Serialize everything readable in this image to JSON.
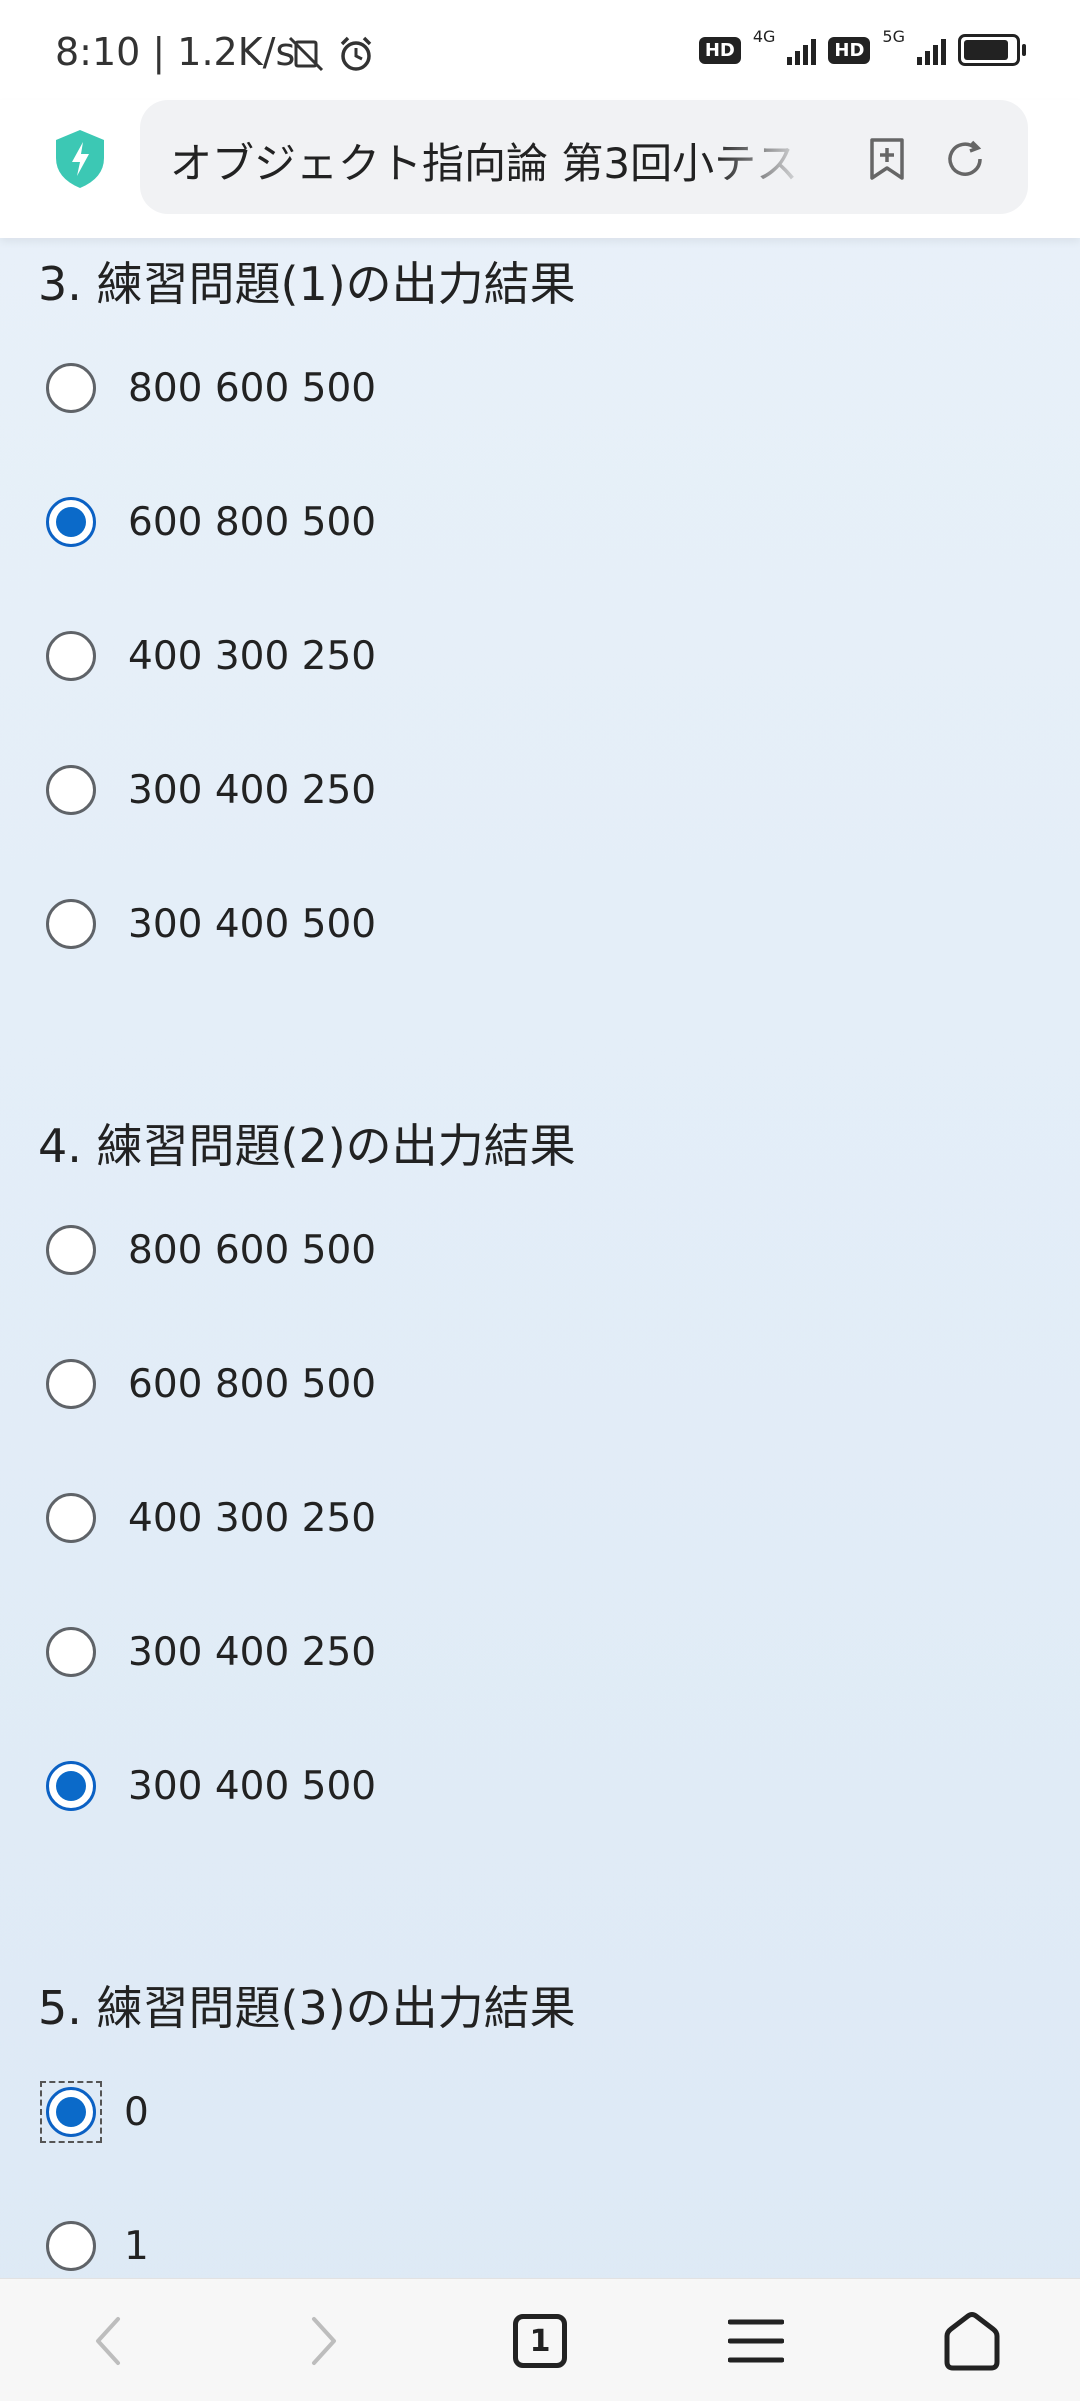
{
  "status": {
    "time": "8:10 | 1.2K/s",
    "hd1": "HD",
    "net1": "4G",
    "hd2": "HD",
    "net2": "5G"
  },
  "address_bar": {
    "page_title": "オブジェクト指向論 第3回小テスト"
  },
  "questions": [
    {
      "title": "3. 練習問題(1)の出力結果",
      "options": [
        {
          "label": "800 600 500",
          "selected": false
        },
        {
          "label": "600 800 500",
          "selected": true
        },
        {
          "label": "400 300 250",
          "selected": false
        },
        {
          "label": "300 400 250",
          "selected": false
        },
        {
          "label": "300 400 500",
          "selected": false
        }
      ]
    },
    {
      "title": "4. 練習問題(2)の出力結果",
      "options": [
        {
          "label": "800 600 500",
          "selected": false
        },
        {
          "label": "600 800 500",
          "selected": false
        },
        {
          "label": "400 300 250",
          "selected": false
        },
        {
          "label": "300 400 250",
          "selected": false
        },
        {
          "label": "300 400 500",
          "selected": true
        }
      ]
    },
    {
      "title": "5. 練習問題(3)の出力結果",
      "options": [
        {
          "label": "0",
          "selected": true,
          "focused": true
        },
        {
          "label": "1",
          "selected": false
        }
      ]
    }
  ],
  "bottom_nav": {
    "tab_count": "1"
  },
  "colors": {
    "accent": "#0b6ac9",
    "shield": "#3cc8b4"
  }
}
